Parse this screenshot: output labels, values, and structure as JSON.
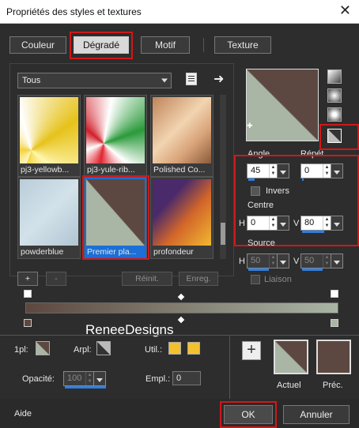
{
  "window": {
    "title": "Propriétés des styles et textures",
    "close_glyph": "✕"
  },
  "tabs": [
    {
      "label": "Couleur"
    },
    {
      "label": "Dégradé"
    },
    {
      "label": "Motif"
    },
    {
      "label": "Texture"
    }
  ],
  "category": {
    "value": "Tous"
  },
  "gradients": [
    {
      "name": "pj3-yellowb..."
    },
    {
      "name": "pj3-yule-rib..."
    },
    {
      "name": "Polished Co..."
    },
    {
      "name": "powderblue"
    },
    {
      "name": "Premier pla..."
    },
    {
      "name": "profondeur"
    }
  ],
  "list_buttons": {
    "add": "+",
    "remove": "-",
    "reset": "Réinit.",
    "save": "Enreg."
  },
  "angle": {
    "label": "Angle",
    "value": "45"
  },
  "repeat": {
    "label": "Répét.",
    "value": "0"
  },
  "invert": {
    "label": "Invers"
  },
  "center": {
    "label": "Centre",
    "h_label": "H",
    "h_value": "0",
    "v_label": "V",
    "v_value": "80"
  },
  "source": {
    "label": "Source",
    "h_label": "H",
    "h_value": "50",
    "v_label": "V",
    "v_value": "50"
  },
  "link": {
    "label": "Liaison"
  },
  "watermark": "ReneeDesigns",
  "bottom": {
    "opl": "1pl:",
    "arpl": "Arpl:",
    "util": "Util.:",
    "opacity_label": "Opacité:",
    "opacity_value": "100",
    "empl_label": "Empl.:",
    "empl_value": "0",
    "current": "Actuel",
    "previous": "Préc."
  },
  "footer": {
    "help": "Aide",
    "ok": "OK",
    "cancel": "Annuler"
  },
  "colors": {
    "light": "#a9b5a5",
    "dark": "#5c4840",
    "accent": "#1b6fd6",
    "red": "#d01818",
    "swatch": "#f2c12e"
  }
}
